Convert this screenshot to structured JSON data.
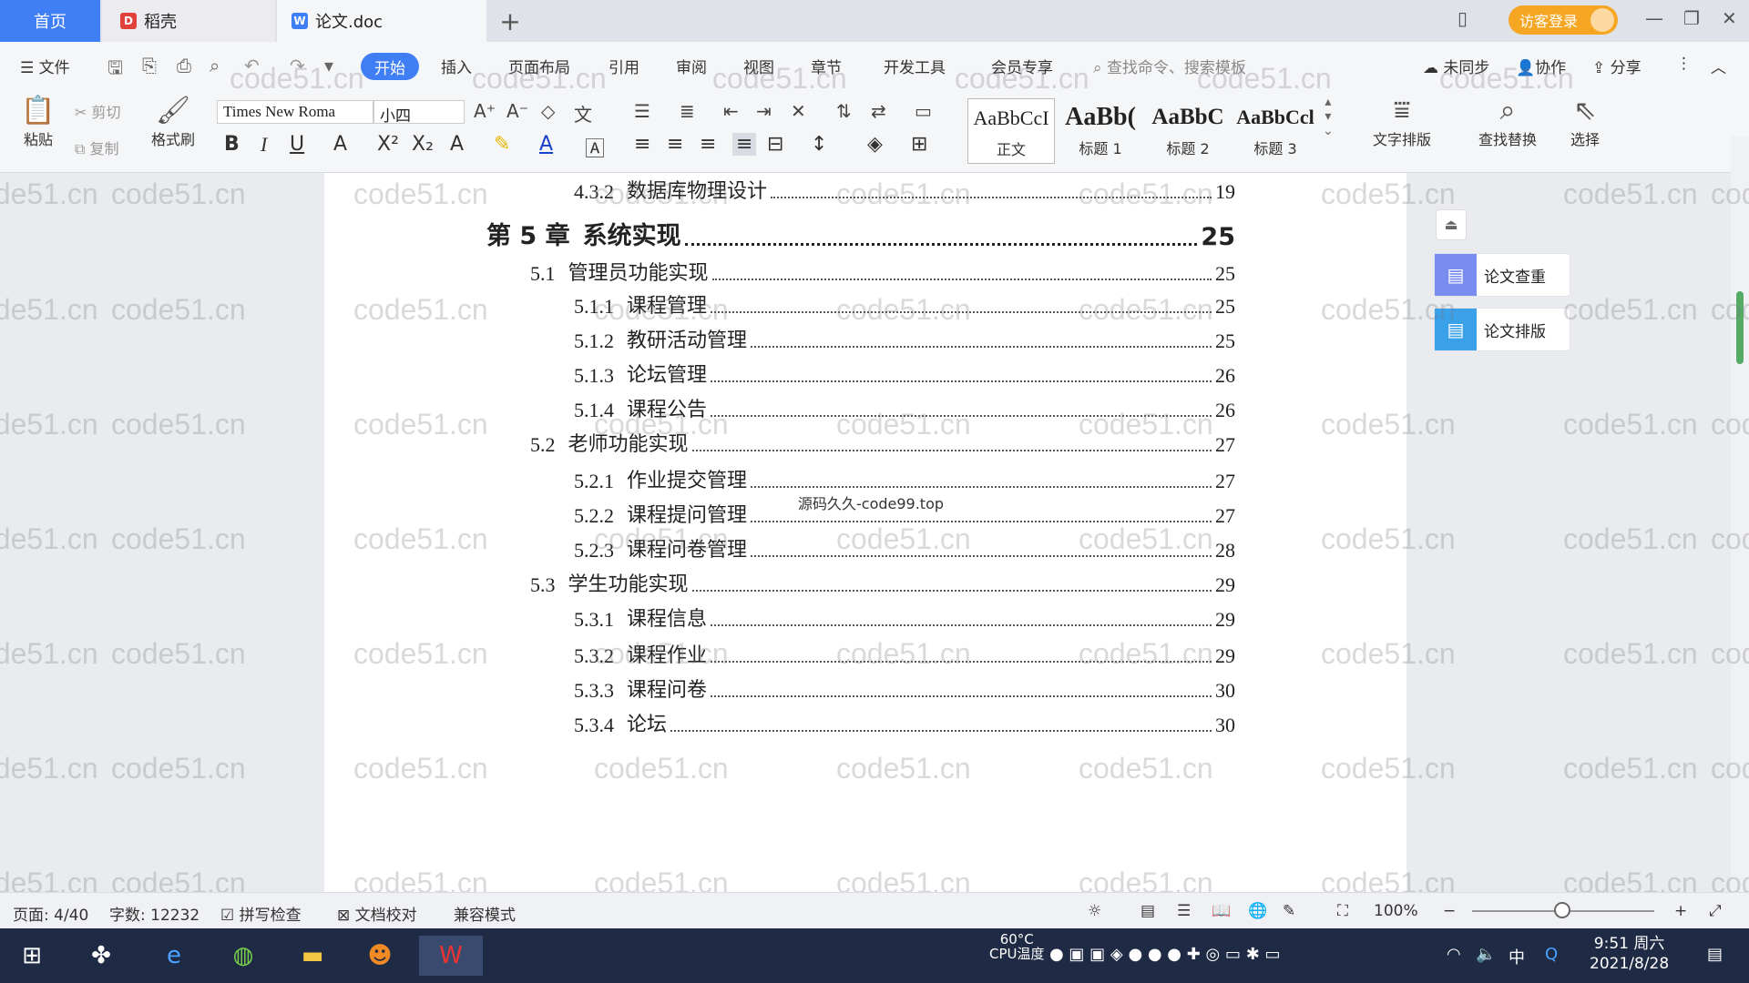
{
  "tabs": {
    "home": "首页",
    "daoke": "稻壳",
    "doc": "论文.doc",
    "add": "+"
  },
  "header": {
    "login": "访客登录"
  },
  "menu": {
    "file": "文件",
    "items": [
      "开始",
      "插入",
      "页面布局",
      "引用",
      "审阅",
      "视图",
      "章节",
      "开发工具",
      "会员专享"
    ],
    "search_placeholder": "查找命令、搜索模板",
    "sync": "未同步",
    "collab": "协作",
    "share": "分享"
  },
  "ribbon": {
    "paste": "粘贴",
    "cut": "剪切",
    "copy": "复制",
    "format_painter": "格式刷",
    "font_name": "Times New Roma",
    "font_size": "小四",
    "styles": [
      {
        "preview": "AaBbCcI",
        "label": "正文"
      },
      {
        "preview": "AaBb(",
        "label": "标题 1"
      },
      {
        "preview": "AaBbC",
        "label": "标题 2"
      },
      {
        "preview": "AaBbCcl",
        "label": "标题 3"
      }
    ],
    "text_layout": "文字排版",
    "find_replace": "查找替换",
    "select": "选择"
  },
  "toc": [
    {
      "level": 2,
      "num": "4.3.2",
      "title": "数据库物理设计",
      "page": "19"
    },
    {
      "level": 0,
      "num": "第 5 章",
      "title": "系统实现",
      "page": "25"
    },
    {
      "level": 1,
      "num": "5.1",
      "title": "管理员功能实现",
      "page": "25"
    },
    {
      "level": 2,
      "num": "5.1.1",
      "title": "课程管理",
      "page": "25"
    },
    {
      "level": 2,
      "num": "5.1.2",
      "title": "教研活动管理",
      "page": "25"
    },
    {
      "level": 2,
      "num": "5.1.3",
      "title": "论坛管理",
      "page": "26"
    },
    {
      "level": 2,
      "num": "5.1.4",
      "title": "课程公告",
      "page": "26"
    },
    {
      "level": 1,
      "num": "5.2",
      "title": "老师功能实现",
      "page": "27"
    },
    {
      "level": 2,
      "num": "5.2.1",
      "title": "作业提交管理",
      "page": "27"
    },
    {
      "level": 2,
      "num": "5.2.2",
      "title": "课程提问管理",
      "page": "27"
    },
    {
      "level": 2,
      "num": "5.2.3",
      "title": "课程问卷管理",
      "page": "28"
    },
    {
      "level": 1,
      "num": "5.3",
      "title": "学生功能实现",
      "page": "29"
    },
    {
      "level": 2,
      "num": "5.3.1",
      "title": "课程信息",
      "page": "29"
    },
    {
      "level": 2,
      "num": "5.3.2",
      "title": "课程作业",
      "page": "29"
    },
    {
      "level": 2,
      "num": "5.3.3",
      "title": "课程问卷",
      "page": "30"
    },
    {
      "level": 2,
      "num": "5.3.4",
      "title": "论坛",
      "page": "30"
    }
  ],
  "overlay_text": "源码久久-code99.top",
  "side": {
    "check": "论文查重",
    "layout": "论文排版"
  },
  "watermark": "code51.cn",
  "status": {
    "page": "页面: 4/40",
    "words": "字数: 12232",
    "spell": "拼写检查",
    "proof": "文档校对",
    "compat": "兼容模式",
    "zoom": "100%"
  },
  "taskbar": {
    "time": "9:51 周六",
    "date": "2021/8/28",
    "cpu_temp": "60°C",
    "cpu_label": "CPU温度",
    "ime": "中"
  }
}
